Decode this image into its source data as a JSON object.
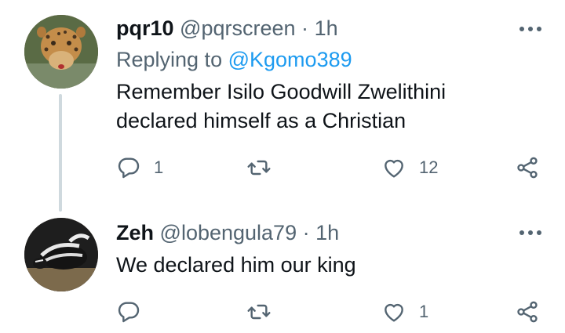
{
  "tweets": [
    {
      "name": "pqr10",
      "handle": "@pqrscreen",
      "separator": "·",
      "time": "1h",
      "replying_prefix": "Replying to",
      "replying_to": "@Kgomo389",
      "text_lines": [
        "Remember Isilo Goodwill Zwelithini",
        "declared himself as a Christian"
      ],
      "reply_count": "1",
      "retweet_count": "",
      "like_count": "12",
      "avatar_icon": "leopard-photo"
    },
    {
      "name": "Zeh",
      "handle": "@lobengula79",
      "separator": "·",
      "time": "1h",
      "text_lines": [
        "We declared him our king"
      ],
      "reply_count": "",
      "retweet_count": "",
      "like_count": "1",
      "avatar_icon": "skunk-photo"
    }
  ],
  "colors": {
    "text_primary": "#0f1419",
    "text_secondary": "#536471",
    "mention": "#1d9bf0",
    "thread_line": "#cfd9de"
  }
}
